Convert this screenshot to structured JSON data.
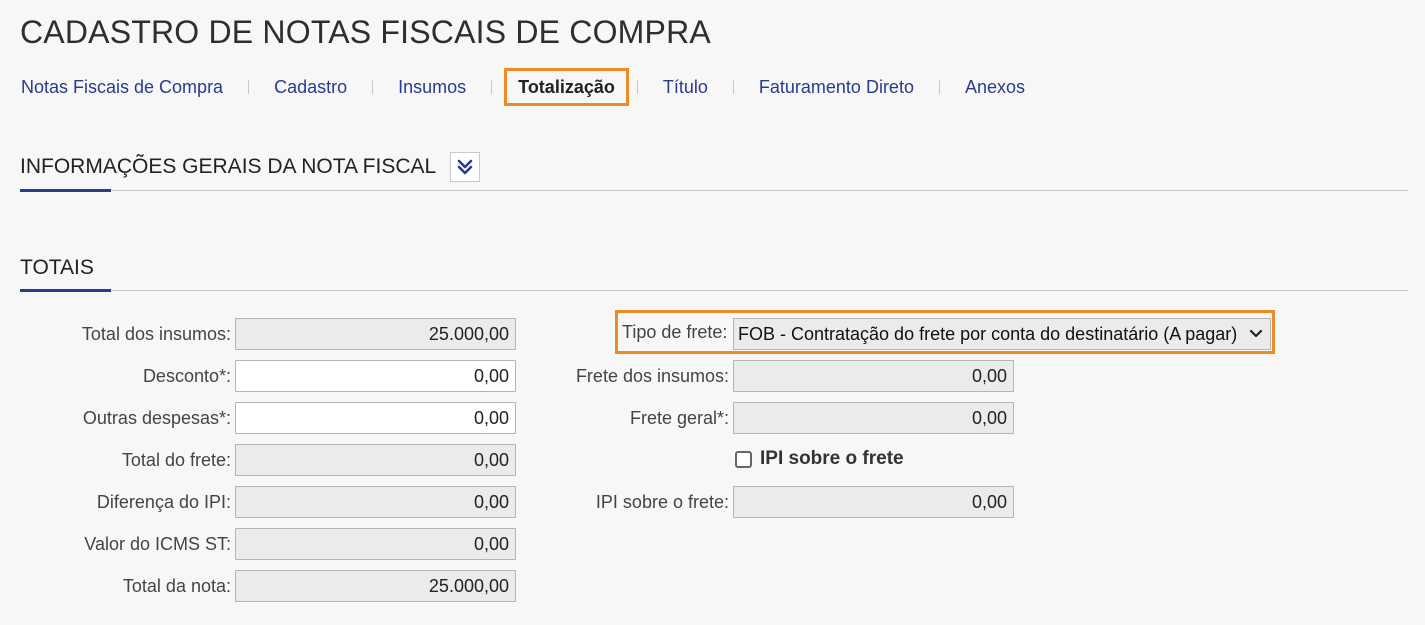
{
  "page": {
    "title": "CADASTRO DE NOTAS FISCAIS DE COMPRA"
  },
  "nav": {
    "items": [
      {
        "label": "Notas Fiscais de Compra"
      },
      {
        "label": "Cadastro"
      },
      {
        "label": "Insumos"
      },
      {
        "label": "Totalização",
        "active": true
      },
      {
        "label": "Título"
      },
      {
        "label": "Faturamento Direto"
      },
      {
        "label": "Anexos"
      }
    ]
  },
  "sections": {
    "general": {
      "title": "INFORMAÇÕES GERAIS DA NOTA FISCAL",
      "expand_icon": "double-chevron-down-icon"
    },
    "totals": {
      "title": "TOTAIS"
    }
  },
  "totals_left": [
    {
      "label": "Total dos insumos:",
      "value": "25.000,00",
      "editable": false
    },
    {
      "label": "Desconto*:",
      "value": "0,00",
      "editable": true
    },
    {
      "label": "Outras despesas*:",
      "value": "0,00",
      "editable": true
    },
    {
      "label": "Total do frete:",
      "value": "0,00",
      "editable": false
    },
    {
      "label": "Diferença do IPI:",
      "value": "0,00",
      "editable": false
    },
    {
      "label": "Valor do ICMS ST:",
      "value": "0,00",
      "editable": false
    },
    {
      "label": "Total da nota:",
      "value": "25.000,00",
      "editable": false
    }
  ],
  "freight": {
    "type_label": "Tipo de frete:",
    "type_value": "FOB - Contratação do frete por conta do destinatário (A pagar)",
    "supplies_label": "Frete dos insumos:",
    "supplies_value": "0,00",
    "general_label": "Frete geral*:",
    "general_value": "0,00",
    "ipi_checkbox_label": "IPI sobre o frete",
    "ipi_checked": false,
    "ipi_label": "IPI sobre o frete:",
    "ipi_value": "0,00"
  },
  "colors": {
    "accent": "#f08a24",
    "nav_link": "#2b3a8c",
    "section_underline": "#2b3a8c"
  }
}
